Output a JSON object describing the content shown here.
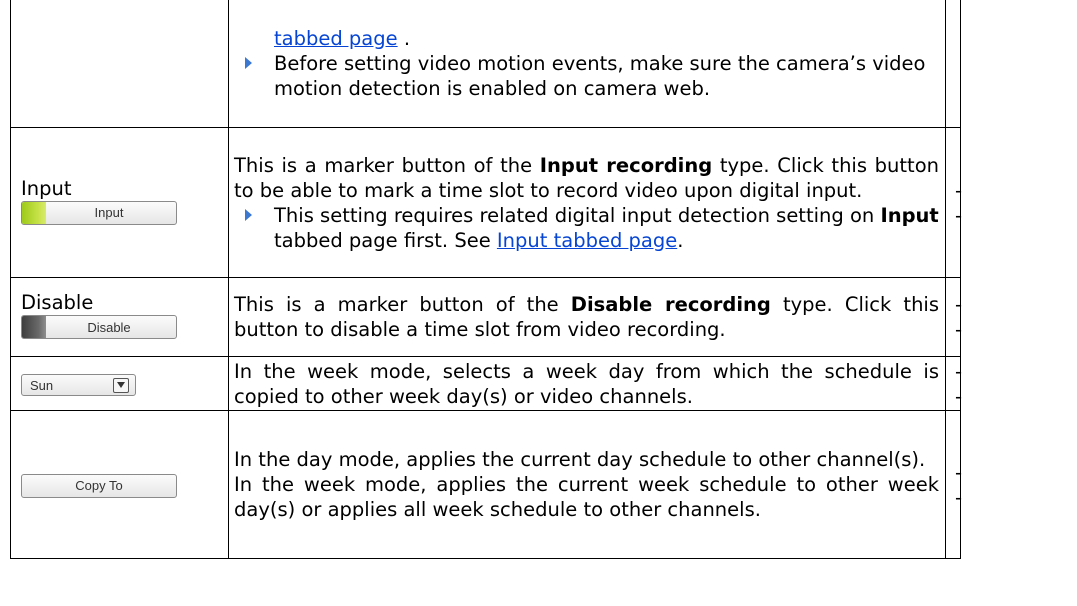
{
  "rows": [
    {
      "description": {
        "link_tail": "tabbed page",
        "link_tail_suffix": " .",
        "bullet": "Before setting video motion events, make sure the camera’s video motion detection is enabled on camera web."
      },
      "note": ""
    },
    {
      "label": "Input",
      "button_label": "Input",
      "button_color": "#b5d62b",
      "description": {
        "p1_before": "This is a marker button of the ",
        "p1_bold": "Input recording",
        "p1_after": " type. Click this button to be able to mark a time slot to record video upon digital input.",
        "bullet_before": "This setting requires related digital input detection setting on ",
        "bullet_bold": "Input",
        "bullet_mid": " tabbed page first. See ",
        "bullet_link": "Input tabbed page",
        "bullet_after": "."
      },
      "note": "--"
    },
    {
      "label": "Disable",
      "button_label": "Disable",
      "button_color": "#4a4a4a",
      "description": {
        "p1_before": "This is a marker button of the ",
        "p1_bold": "Disable recording",
        "p1_after": " type. Click this button to disable a time slot from video recording."
      },
      "note": "--"
    },
    {
      "select_value": "Sun",
      "description": {
        "p1": "In the week mode, selects a week day from which the schedule is copied to other week day(s) or video channels."
      },
      "note": "--"
    },
    {
      "button_label": "Copy To",
      "description": {
        "p1": "In the day mode, applies the current day schedule to other channel(s).",
        "p2": "In the week mode, applies the current week schedule to other week day(s) or applies all week schedule to other channels."
      },
      "note": "--"
    }
  ],
  "colors": {
    "link": "#0645d4",
    "bullet": "#3b78d2"
  },
  "icons": {
    "bullet": "triangle-right-icon",
    "select_arrow": "chevron-down-icon"
  }
}
